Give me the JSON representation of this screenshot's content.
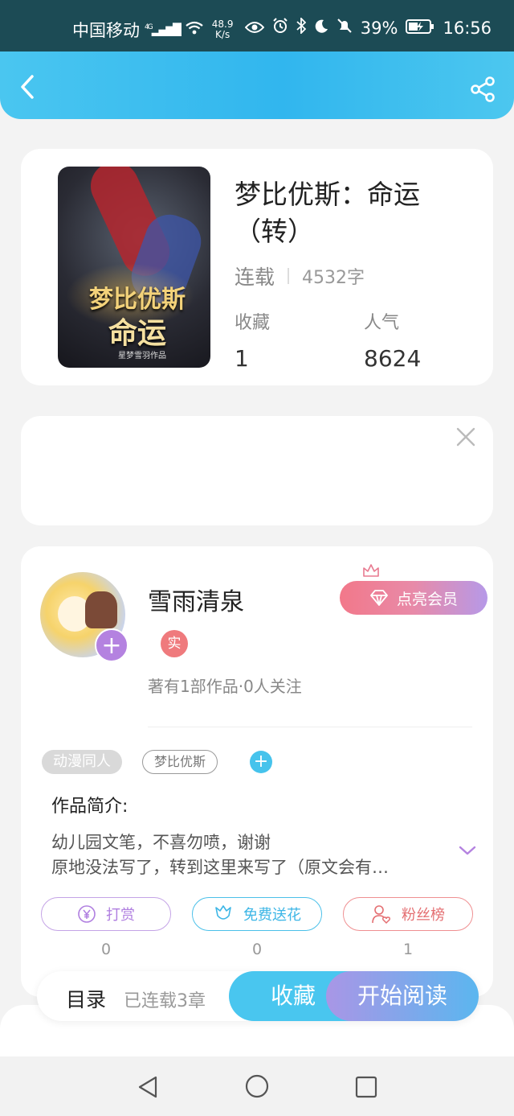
{
  "status_bar": {
    "carrier": "中国移动",
    "network": "4G",
    "speed_value": "48.9",
    "speed_unit": "K/s",
    "battery": "39%",
    "time": "16:56"
  },
  "book": {
    "title": "梦比优斯：命运（转）",
    "status": "连载",
    "word_count": "4532字",
    "cover_title_line1": "梦比优斯",
    "cover_title_line2": "命运",
    "cover_author": "星梦雪羽作品",
    "stats": [
      {
        "label": "收藏",
        "value": "1"
      },
      {
        "label": "人气",
        "value": "8624"
      }
    ]
  },
  "author": {
    "name": "雪雨清泉",
    "real_badge": "实",
    "info": "著有1部作品·0人关注",
    "vip_button": "点亮会员"
  },
  "tags": [
    "动漫同人",
    "梦比优斯"
  ],
  "intro": {
    "title": "作品简介:",
    "line1": "幼儿园文笔，不喜勿喷，谢谢",
    "line2": "原地没法写了，转到这里来写了（原文会有…"
  },
  "actions": [
    {
      "label": "打赏",
      "count": "0",
      "icon": "yen-icon"
    },
    {
      "label": "免费送花",
      "count": "0",
      "icon": "flower-icon"
    },
    {
      "label": "粉丝榜",
      "count": "1",
      "icon": "fans-icon"
    }
  ],
  "bottom_bar": {
    "toc_label": "目录",
    "toc_status": "已连载3章",
    "collect_label": "收藏",
    "read_label": "开始阅读"
  },
  "colors": {
    "accent_blue": "#49c6ef",
    "accent_purple": "#b482e0",
    "accent_red": "#ef7a7d"
  }
}
